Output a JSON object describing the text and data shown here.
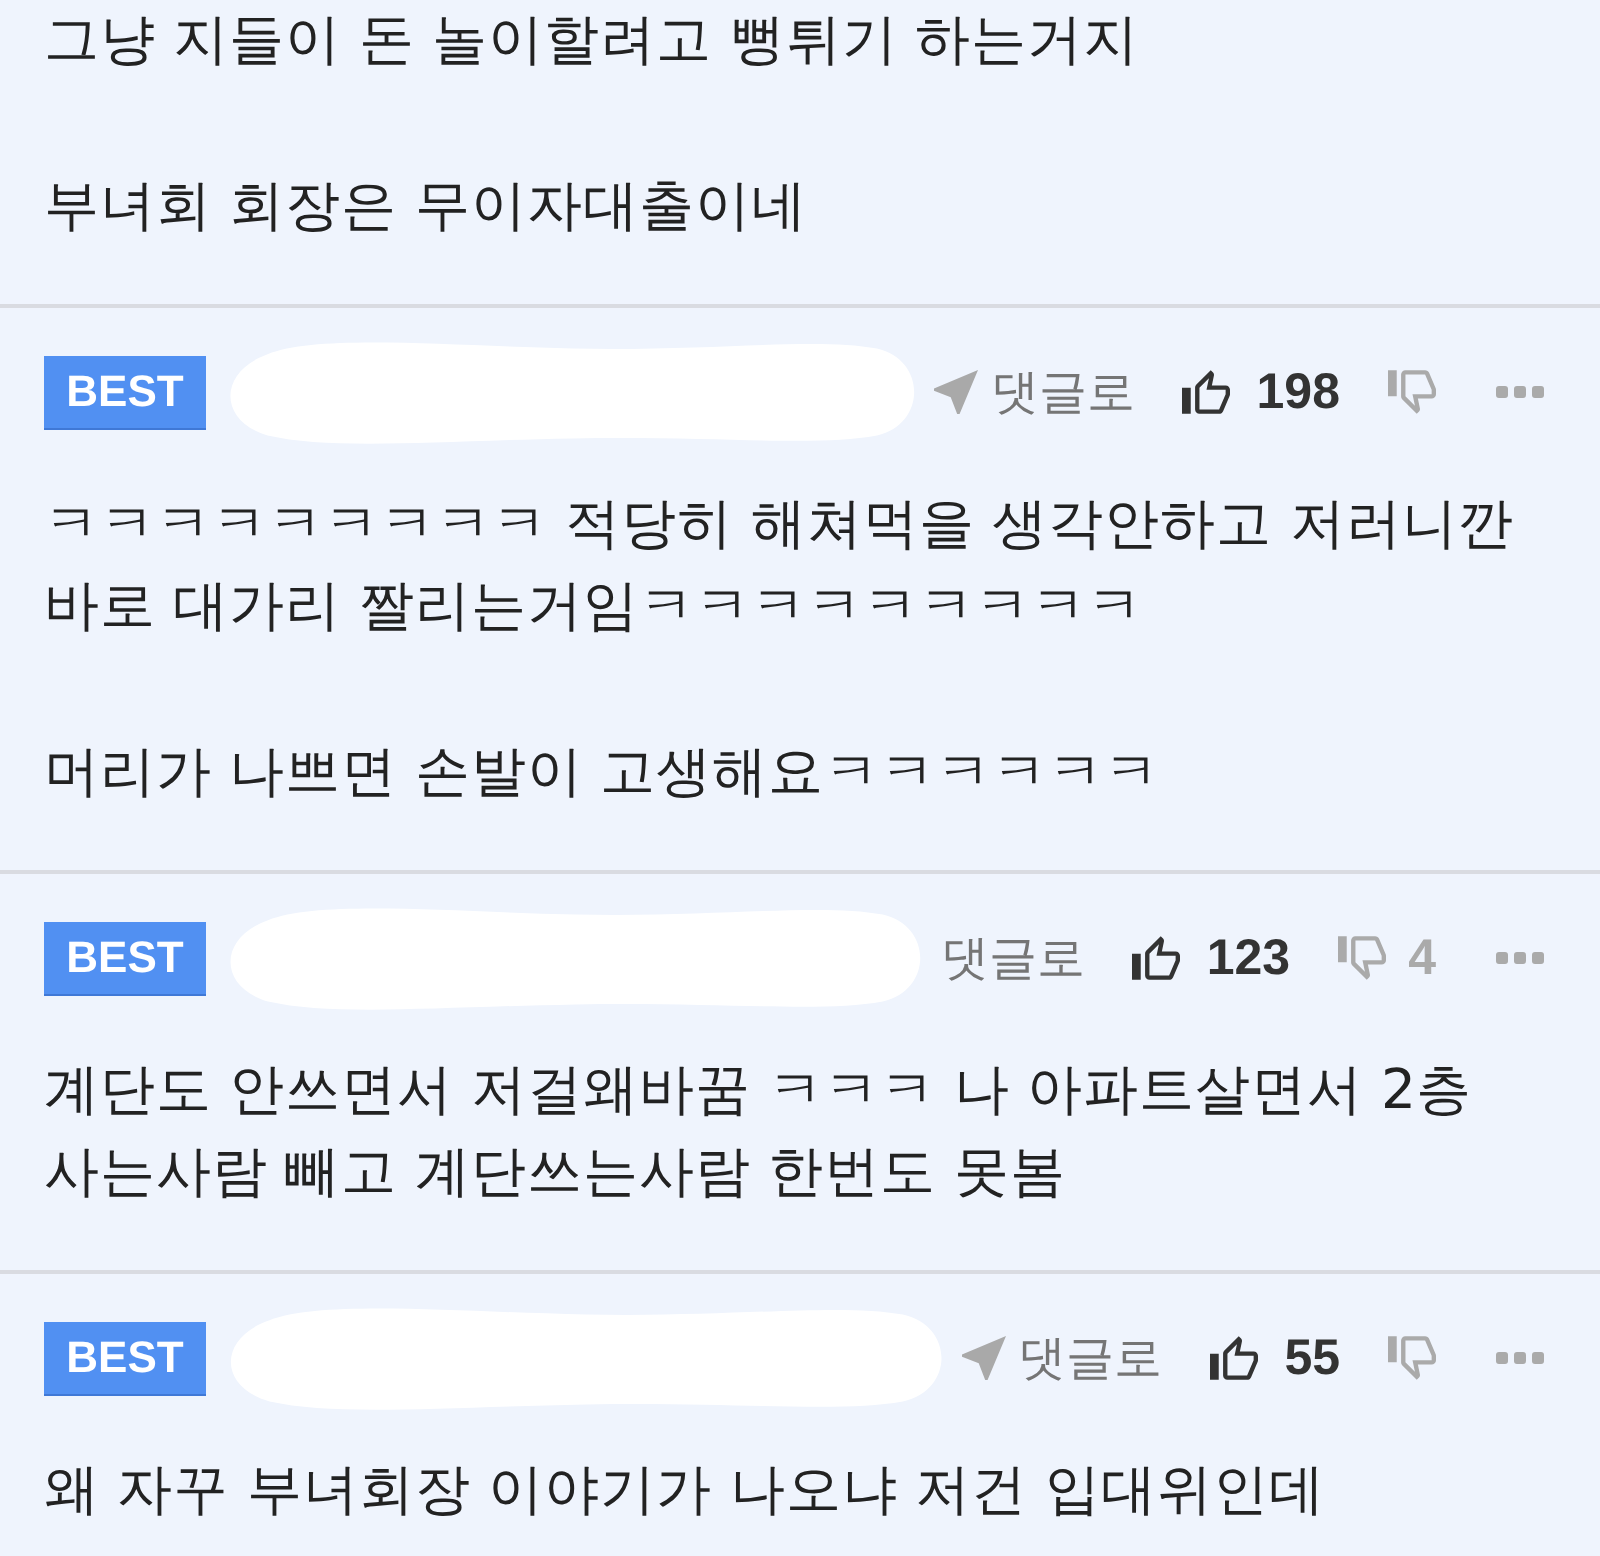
{
  "comments": [
    {
      "paragraphs": [
        {
          "lines": [
            "그냥 지들이 돈 놀이할려고 뻥튀기 하는거지"
          ]
        },
        {
          "lines": [
            "부녀회 회장은 무이자대출이네"
          ]
        }
      ]
    },
    {
      "header": {
        "badge": "BEST",
        "reply": {
          "icon": true,
          "label": "댓글로"
        },
        "likes": "198"
      },
      "paragraphs": [
        {
          "lines": [
            "ㅋㅋㅋㅋㅋㅋㅋㅋㅋ 적당히 해쳐먹을 생각안하고 저러니깐",
            "바로 대가리 짤리는거임ㅋㅋㅋㅋㅋㅋㅋㅋㅋ"
          ]
        },
        {
          "lines": [
            "머리가 나쁘면 손발이 고생해요ㅋㅋㅋㅋㅋㅋ"
          ]
        }
      ]
    },
    {
      "header": {
        "badge": "BEST",
        "reply": {
          "icon": false,
          "label": "댓글로"
        },
        "likes": "123",
        "dislikes": "4"
      },
      "paragraphs": [
        {
          "lines": [
            "계단도 안쓰면서 저걸왜바꿈 ㅋㅋㅋ 나 아파트살면서 2층",
            "사는사람 빼고 계단쓰는사람 한번도 못봄"
          ]
        }
      ]
    },
    {
      "header": {
        "badge": "BEST",
        "reply": {
          "icon": true,
          "label": "댓글로"
        },
        "likes": "55"
      },
      "paragraphs": [
        {
          "lines": [
            "왜 자꾸 부녀회장 이야기가 나오냐 저건 입대위인데"
          ]
        }
      ]
    }
  ]
}
